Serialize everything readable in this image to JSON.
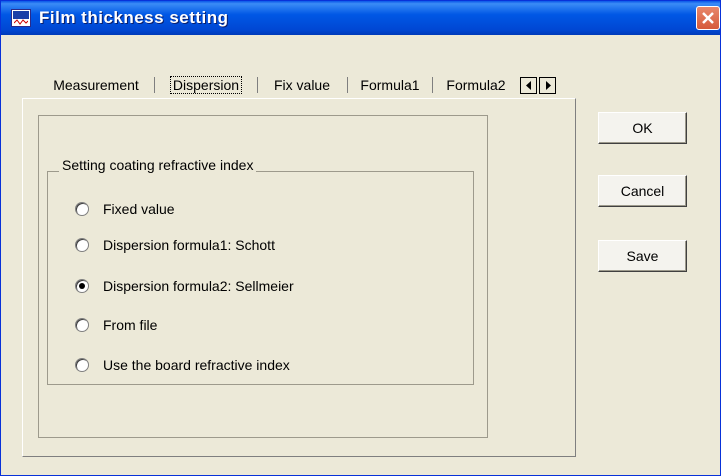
{
  "window": {
    "title": "Film thickness setting",
    "icon": "app-icon"
  },
  "tabs": [
    {
      "label": "Measurement",
      "active": false
    },
    {
      "label": "Dispersion",
      "active": true
    },
    {
      "label": "Fix value",
      "active": false
    },
    {
      "label": "Formula1",
      "active": false
    },
    {
      "label": "Formula2",
      "active": false
    }
  ],
  "group": {
    "legend": "Setting coating refractive index",
    "options": [
      {
        "label": "Fixed value",
        "selected": false
      },
      {
        "label": "Dispersion formula1: Schott",
        "selected": false
      },
      {
        "label": "Dispersion formula2: Sellmeier",
        "selected": true
      },
      {
        "label": "From file",
        "selected": false
      },
      {
        "label": "Use the board refractive index",
        "selected": false
      }
    ]
  },
  "buttons": {
    "ok": "OK",
    "cancel": "Cancel",
    "save": "Save"
  },
  "colors": {
    "titlebar": "#0057e5",
    "dialog_bg": "#ece9d8",
    "close": "#d65a3a"
  }
}
